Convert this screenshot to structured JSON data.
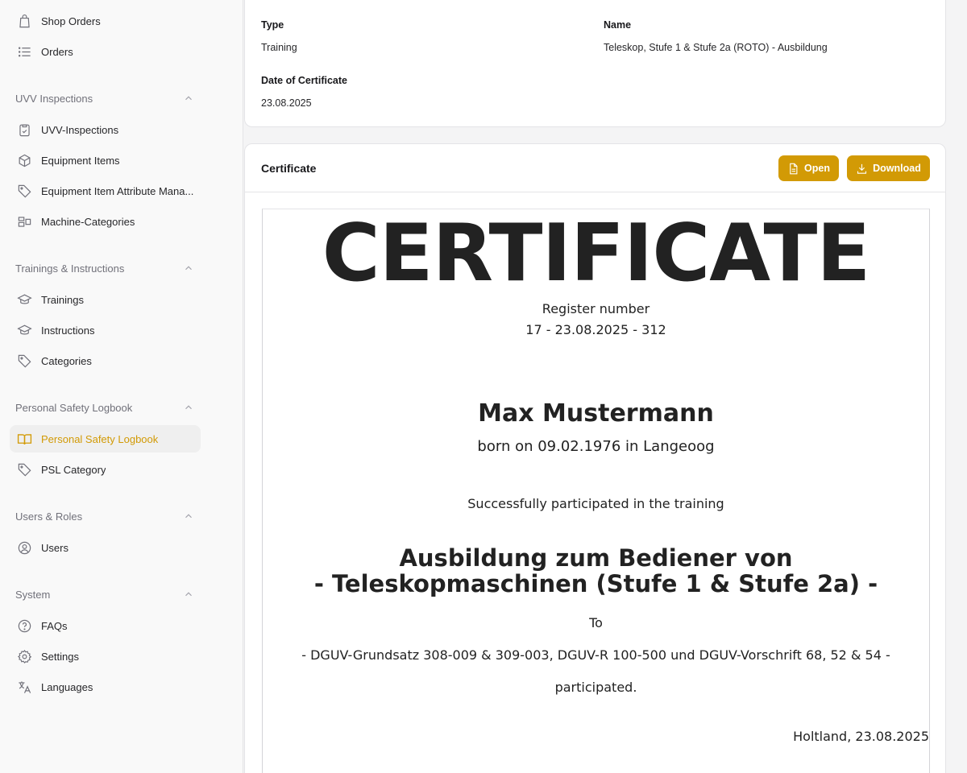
{
  "sidebar": {
    "top_items": [
      {
        "label": "Shop Orders",
        "icon": "shopping-bag-icon"
      },
      {
        "label": "Orders",
        "icon": "list-icon"
      }
    ],
    "groups": [
      {
        "label": "UVV Inspections",
        "items": [
          {
            "label": "UVV-Inspections",
            "icon": "clipboard-check-icon"
          },
          {
            "label": "Equipment Items",
            "icon": "cube-icon"
          },
          {
            "label": "Equipment Item Attribute Mana...",
            "icon": "tag-icon"
          },
          {
            "label": "Machine-Categories",
            "icon": "categories-icon"
          }
        ]
      },
      {
        "label": "Trainings & Instructions",
        "items": [
          {
            "label": "Trainings",
            "icon": "graduation-cap-icon"
          },
          {
            "label": "Instructions",
            "icon": "graduation-cap-icon"
          },
          {
            "label": "Categories",
            "icon": "tag-icon"
          }
        ]
      },
      {
        "label": "Personal Safety Logbook",
        "items": [
          {
            "label": "Personal Safety Logbook",
            "icon": "book-open-icon",
            "active": true
          },
          {
            "label": "PSL Category",
            "icon": "tag-icon"
          }
        ]
      },
      {
        "label": "Users & Roles",
        "items": [
          {
            "label": "Users",
            "icon": "user-circle-icon"
          }
        ]
      },
      {
        "label": "System",
        "items": [
          {
            "label": "FAQs",
            "icon": "question-circle-icon"
          },
          {
            "label": "Settings",
            "icon": "cog-icon"
          },
          {
            "label": "Languages",
            "icon": "language-icon"
          }
        ]
      }
    ]
  },
  "details": {
    "type_label": "Type",
    "type_value": "Training",
    "name_label": "Name",
    "name_value": "Teleskop, Stufe 1 & Stufe 2a (ROTO) - Ausbildung",
    "date_label": "Date of Certificate",
    "date_value": "23.08.2025"
  },
  "certificate": {
    "section_title": "Certificate",
    "open_label": "Open",
    "download_label": "Download",
    "doc": {
      "heading": "CERTIFICATE",
      "register_label": "Register number",
      "register_number": "17 - 23.08.2025 - 312",
      "person_name": "Max Mustermann",
      "born": "born on 09.02.1976 in Langeoog",
      "participated_intro": "Successfully participated in the training",
      "training_line1": "Ausbildung zum Bediener von",
      "training_line2": "- Teleskopmaschinen (Stufe 1 & Stufe 2a) -",
      "to": "To",
      "regulations": "- DGUV-Grundsatz 308-009 & 309-003, DGUV-R 100-500 und DGUV-Vorschrift 68, 52 & 54 -",
      "participated": "participated.",
      "place_date": "Holtland, 23.08.2025"
    }
  },
  "colors": {
    "accent": "#d29a05",
    "sidebar_bg": "#f9f9f9",
    "page_bg": "#f4f4f5"
  }
}
